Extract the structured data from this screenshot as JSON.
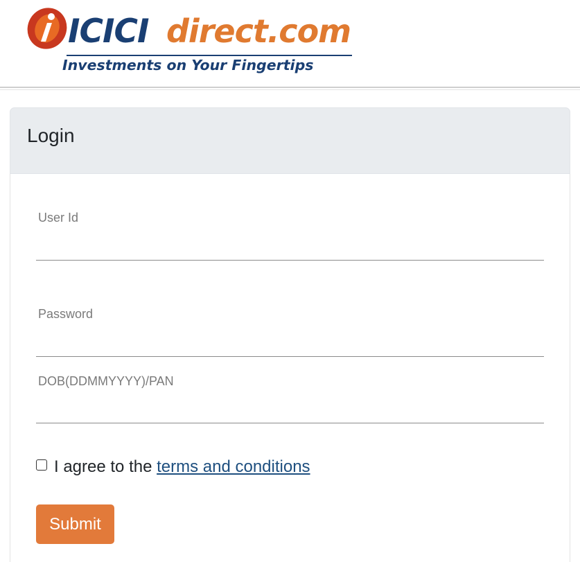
{
  "header": {
    "logo": {
      "brand_primary": "ICICI",
      "brand_secondary": "direct.com",
      "tagline": "Investments on Your Fingertips",
      "colors": {
        "navy": "#1a3f73",
        "orange": "#e07a30",
        "mark_red": "#c8381f"
      }
    }
  },
  "login": {
    "title": "Login",
    "fields": {
      "user_id": {
        "label": "User Id",
        "value": ""
      },
      "password": {
        "label": "Password",
        "value": ""
      },
      "dob_pan": {
        "label": "DOB(DDMMYYYY)/PAN",
        "value": ""
      }
    },
    "agree": {
      "checked": false,
      "prefix": "I agree to the",
      "link_text": "terms and conditions"
    },
    "submit_label": "Submit"
  },
  "colors": {
    "card_header_bg": "#e9ecef",
    "submit_bg": "#e27a3a",
    "link": "#1e4f7f"
  }
}
